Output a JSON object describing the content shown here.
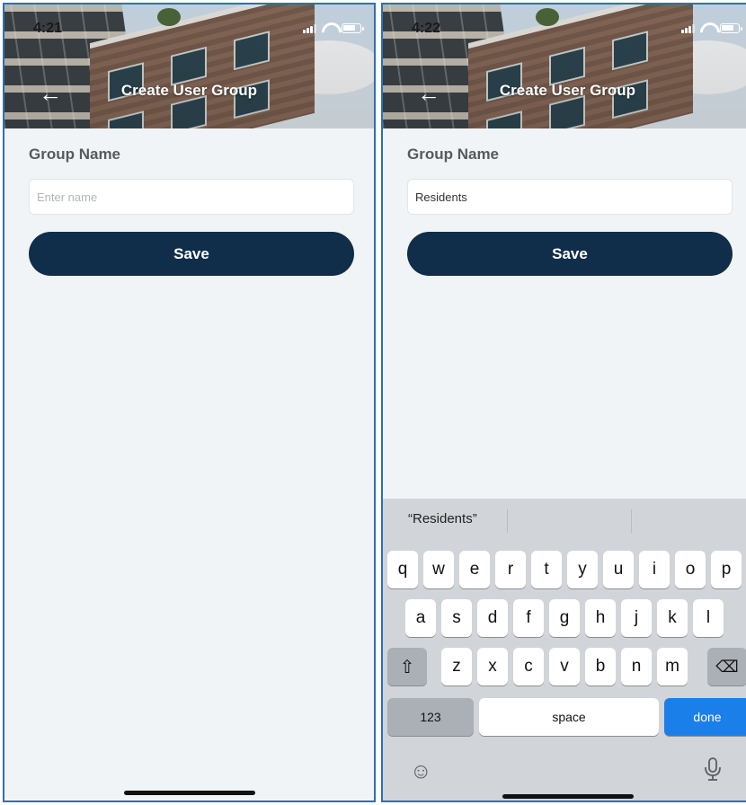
{
  "screens": [
    {
      "status_time": "4:21",
      "header_title": "Create User Group",
      "group_label": "Group Name",
      "input_value": "",
      "input_placeholder": "Enter name",
      "save_label": "Save"
    },
    {
      "status_time": "4:22",
      "header_title": "Create User Group",
      "group_label": "Group Name",
      "input_value": "Residents",
      "input_placeholder": "Enter name",
      "save_label": "Save",
      "keyboard": {
        "suggestion": "“Residents”",
        "row1": [
          "q",
          "w",
          "e",
          "r",
          "t",
          "y",
          "u",
          "i",
          "o",
          "p"
        ],
        "row2": [
          "a",
          "s",
          "d",
          "f",
          "g",
          "h",
          "j",
          "k",
          "l"
        ],
        "row3": [
          "z",
          "x",
          "c",
          "v",
          "b",
          "n",
          "m"
        ],
        "numbers_key": "123",
        "space_key": "space",
        "done_key": "done",
        "shift_icon": "shift-icon",
        "delete_icon": "backspace-icon",
        "emoji_icon": "emoji-icon",
        "mic_icon": "microphone-icon"
      }
    }
  ],
  "colors": {
    "save_button": "#102d4a",
    "done_key": "#1a7fe8",
    "frame_border": "#2f6fb5"
  }
}
